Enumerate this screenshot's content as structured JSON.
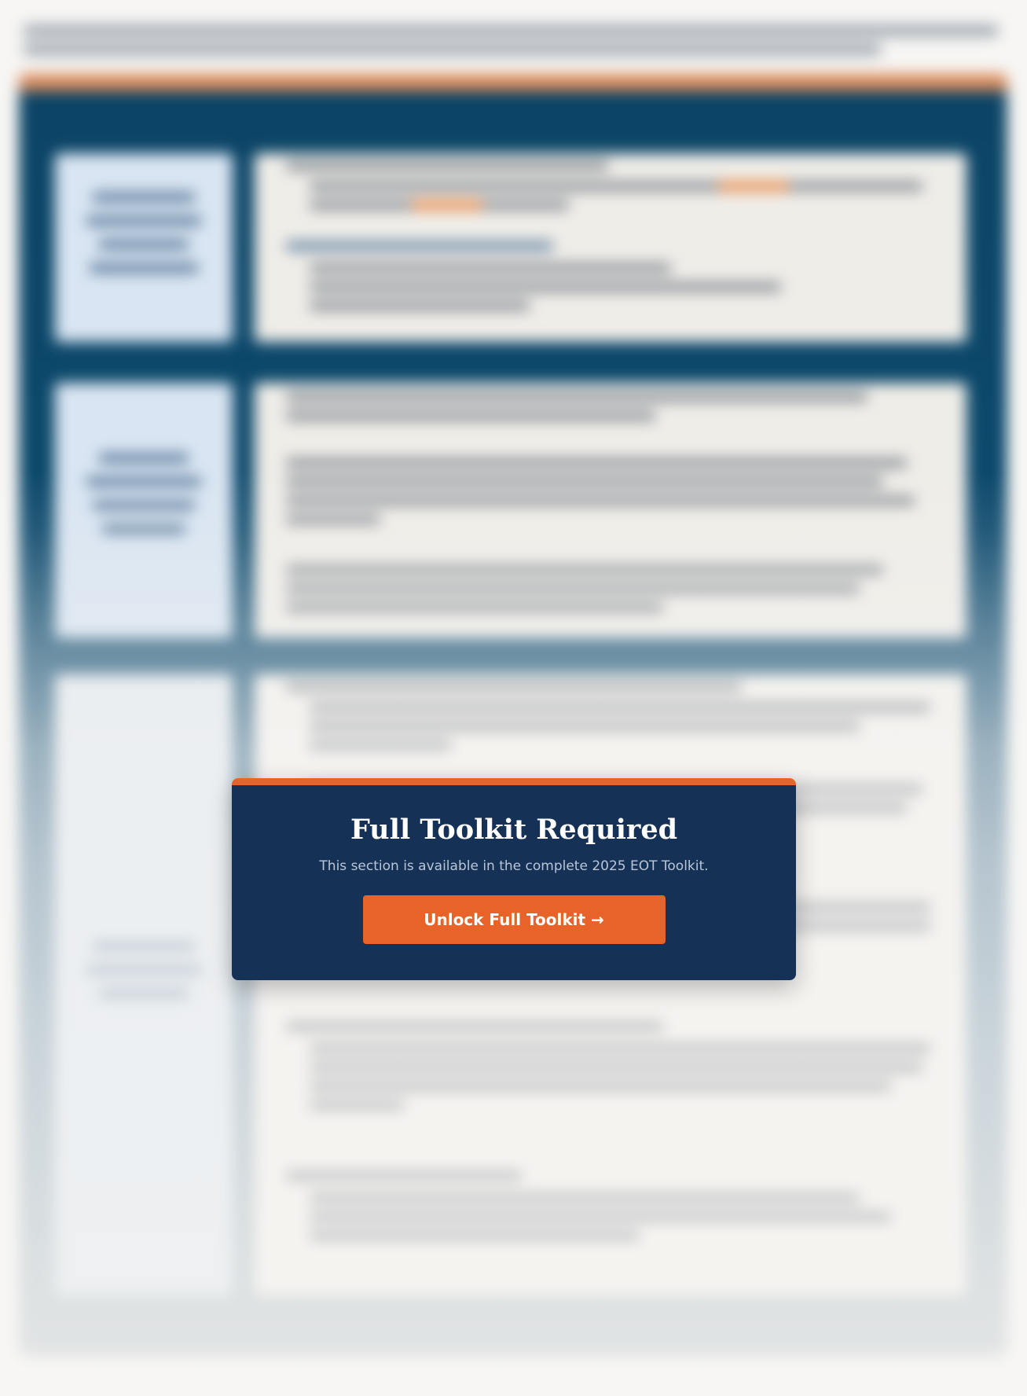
{
  "paywall": {
    "title": "Full Toolkit Required",
    "subtitle": "This section is available in the complete 2025 EOT Toolkit.",
    "button_label": "Unlock Full Toolkit →"
  },
  "colors": {
    "card_background": "#163156",
    "accent": "#e8632a",
    "frame": "#0b4466"
  }
}
